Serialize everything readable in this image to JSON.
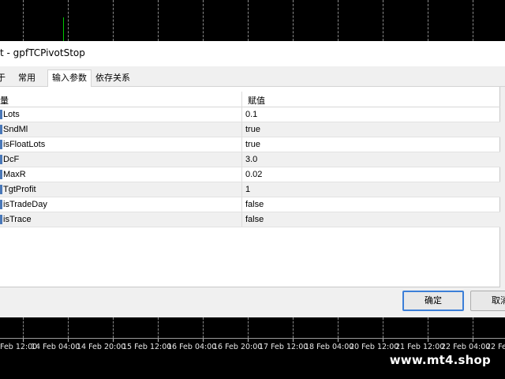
{
  "dialog": {
    "title": "t - gpfTCPivotStop",
    "tabs": [
      {
        "label": "于"
      },
      {
        "label": "常用"
      },
      {
        "label": "输入参数"
      },
      {
        "label": "依存关系"
      }
    ],
    "grid": {
      "col_name": "量",
      "col_value": "赋值",
      "rows": [
        {
          "name": "Lots",
          "value": "0.1"
        },
        {
          "name": "SndMl",
          "value": "true"
        },
        {
          "name": "isFloatLots",
          "value": "true"
        },
        {
          "name": "DcF",
          "value": "3.0"
        },
        {
          "name": "MaxR",
          "value": "0.02"
        },
        {
          "name": "TgtProfit",
          "value": "1"
        },
        {
          "name": "isTradeDay",
          "value": "false"
        },
        {
          "name": "isTrace",
          "value": "false"
        }
      ]
    },
    "ok_label": "确定",
    "cancel_label": "取消"
  },
  "chart": {
    "time_labels": [
      "Feb 12:00",
      "14 Feb 04:00",
      "14 Feb 20:00",
      "15 Feb 12:00",
      "16 Feb 04:00",
      "16 Feb 20:00",
      "17 Feb 12:00",
      "18 Feb 04:00",
      "20 Feb 12:00",
      "21 Feb 12:00",
      "22 Feb 04:00",
      "22 Fe"
    ],
    "watermark": "www.mt4.shop",
    "colors": {
      "background": "#000000",
      "grid": "#8a8a8a",
      "candle_bull": "#00c800",
      "ok_border": "#3c7fd8"
    }
  }
}
